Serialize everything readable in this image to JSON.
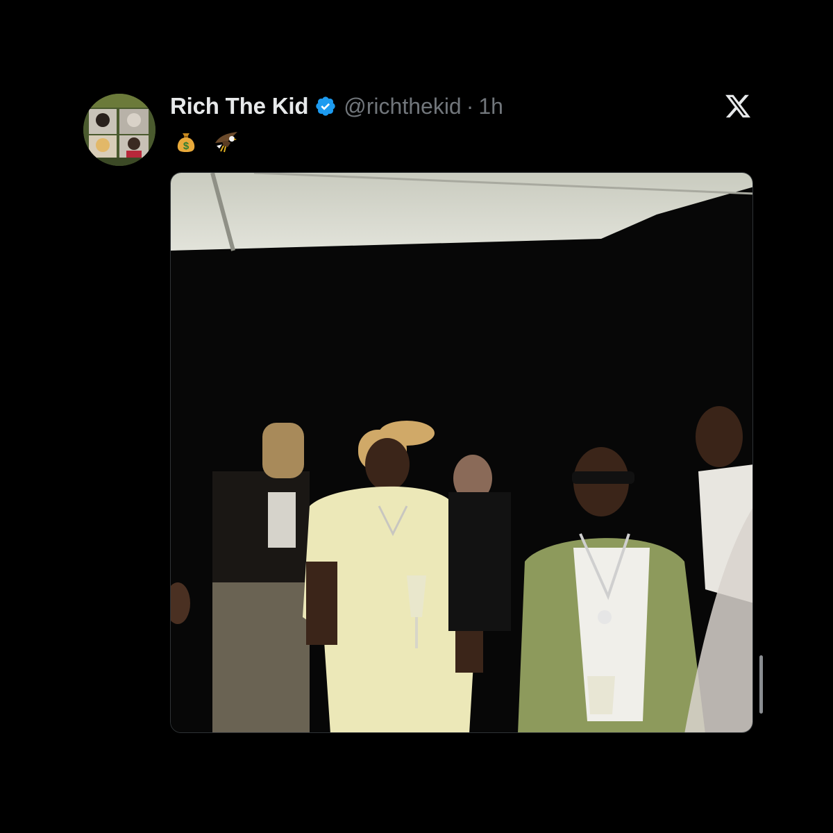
{
  "tweet": {
    "author": {
      "display_name": "Rich The Kid",
      "handle": "@richthekid",
      "verified": true
    },
    "separator": "·",
    "time": "1h",
    "text_emojis": [
      "money-bag",
      "eagle"
    ]
  },
  "icons": {
    "brand": "x-logo",
    "verified": "verified-badge-icon"
  },
  "colors": {
    "background": "#000000",
    "primary_text": "#e7e9ea",
    "secondary_text": "#71767b",
    "verified_blue": "#1d9bf0"
  }
}
